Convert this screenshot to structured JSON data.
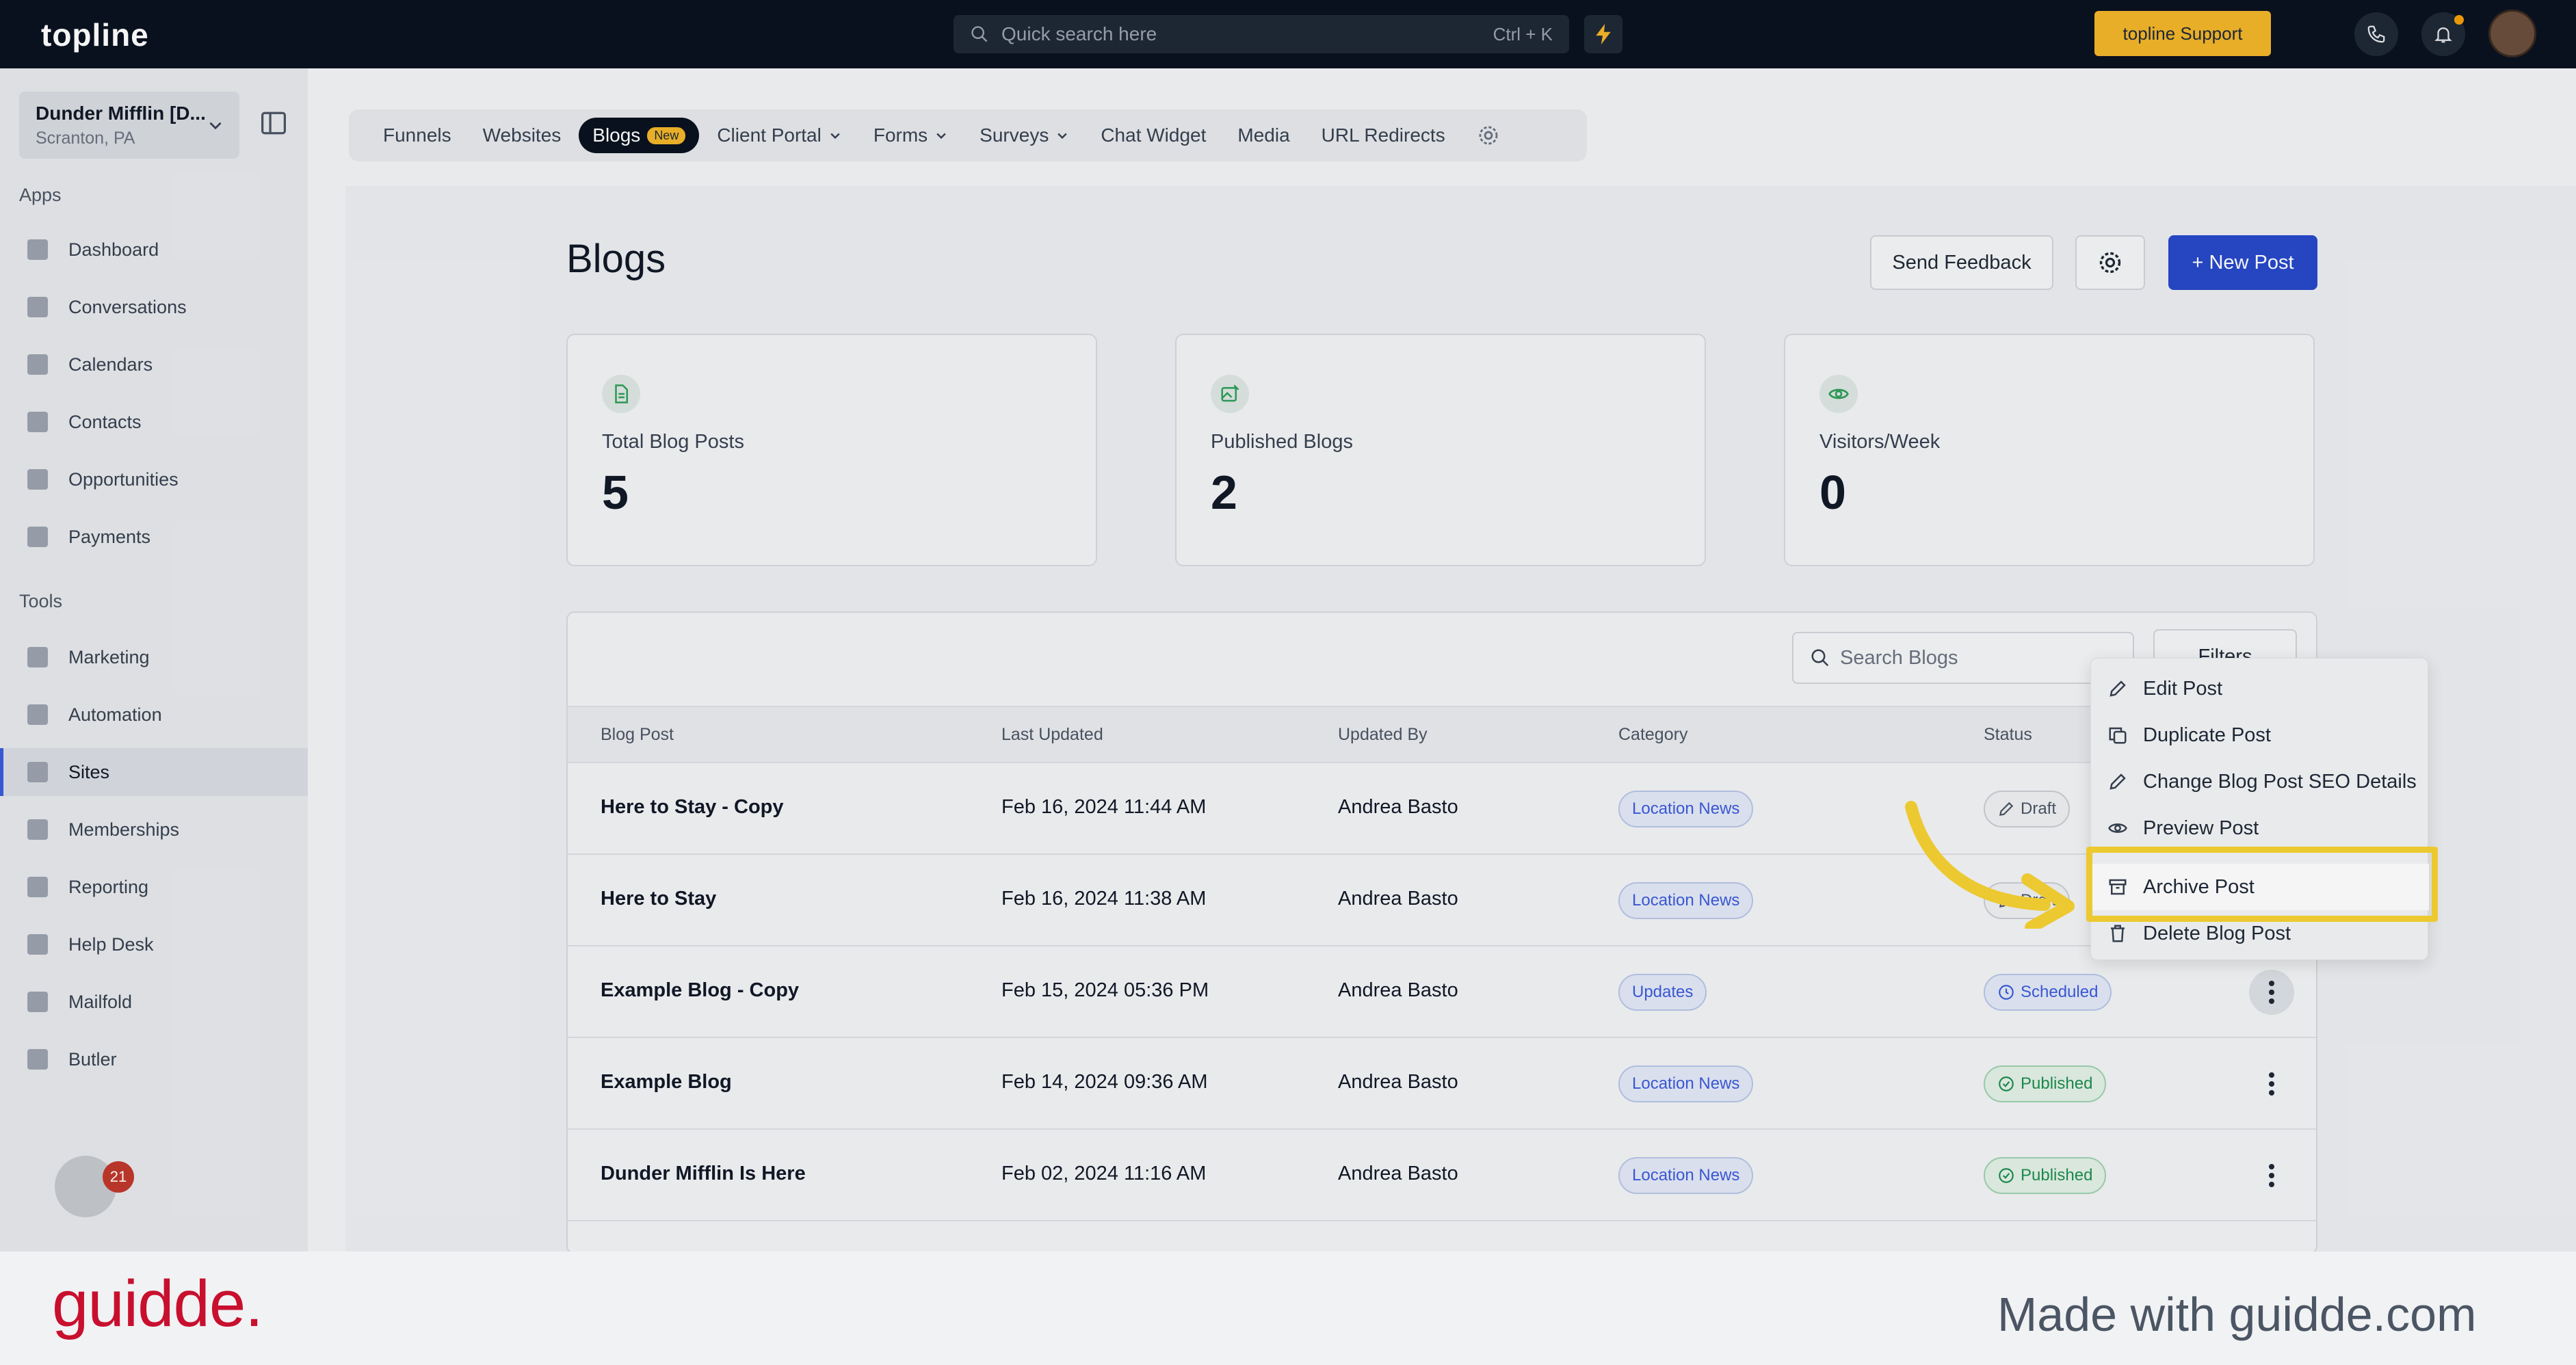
{
  "topbar": {
    "logo": "topline",
    "search_placeholder": "Quick search here",
    "search_shortcut": "Ctrl + K",
    "support_label": "topline Support"
  },
  "sidebar": {
    "account_name": "Dunder Mifflin [D...",
    "account_location": "Scranton, PA",
    "apps_label": "Apps",
    "tools_label": "Tools",
    "apps": [
      {
        "label": "Dashboard",
        "icon": "dashboard-icon"
      },
      {
        "label": "Conversations",
        "icon": "chat-icon"
      },
      {
        "label": "Calendars",
        "icon": "calendar-icon"
      },
      {
        "label": "Contacts",
        "icon": "person-icon"
      },
      {
        "label": "Opportunities",
        "icon": "target-icon"
      },
      {
        "label": "Payments",
        "icon": "card-icon"
      }
    ],
    "tools": [
      {
        "label": "Marketing",
        "icon": "megaphone-icon"
      },
      {
        "label": "Automation",
        "icon": "gears-icon"
      },
      {
        "label": "Sites",
        "icon": "globe-icon",
        "active": true
      },
      {
        "label": "Memberships",
        "icon": "users-icon"
      },
      {
        "label": "Reporting",
        "icon": "pie-icon"
      },
      {
        "label": "Help Desk",
        "icon": "help-icon"
      },
      {
        "label": "Mailfold",
        "icon": "mail-icon"
      },
      {
        "label": "Butler",
        "icon": "butler-icon"
      }
    ],
    "badge_count": "21"
  },
  "subnav": {
    "tabs": [
      "Funnels",
      "Websites",
      "Blogs",
      "Client Portal",
      "Forms",
      "Surveys",
      "Chat Widget",
      "Media",
      "URL Redirects"
    ],
    "new_badge": "New"
  },
  "page": {
    "title": "Blogs",
    "send_feedback": "Send Feedback",
    "new_post": "+ New Post"
  },
  "stats": [
    {
      "label": "Total Blog Posts",
      "value": "5",
      "icon": "document-icon"
    },
    {
      "label": "Published Blogs",
      "value": "2",
      "icon": "image-edit-icon"
    },
    {
      "label": "Visitors/Week",
      "value": "0",
      "icon": "eye-icon"
    }
  ],
  "table": {
    "search_placeholder": "Search Blogs",
    "filters_label": "Filters",
    "headers": [
      "Blog Post",
      "Last Updated",
      "Updated By",
      "Category",
      "Status"
    ],
    "rows": [
      {
        "title": "Here to Stay - Copy",
        "updated": "Feb 16, 2024 11:44 AM",
        "by": "Andrea Basto",
        "category": "Location News",
        "status": "Draft",
        "status_type": "draft"
      },
      {
        "title": "Here to Stay",
        "updated": "Feb 16, 2024 11:38 AM",
        "by": "Andrea Basto",
        "category": "Location News",
        "status": "Draft",
        "status_type": "draft"
      },
      {
        "title": "Example Blog - Copy",
        "updated": "Feb 15, 2024 05:36 PM",
        "by": "Andrea Basto",
        "category": "Updates",
        "status": "Scheduled",
        "status_type": "sched"
      },
      {
        "title": "Example Blog",
        "updated": "Feb 14, 2024 09:36 AM",
        "by": "Andrea Basto",
        "category": "Location News",
        "status": "Published",
        "status_type": "pub"
      },
      {
        "title": "Dunder Mifflin Is Here",
        "updated": "Feb 02, 2024 11:16 AM",
        "by": "Andrea Basto",
        "category": "Location News",
        "status": "Published",
        "status_type": "pub"
      }
    ]
  },
  "menu": {
    "items": [
      {
        "label": "Edit Post",
        "icon": "pencil-icon"
      },
      {
        "label": "Duplicate Post",
        "icon": "copy-icon"
      },
      {
        "label": "Change Blog Post SEO Details",
        "icon": "pencil-icon"
      },
      {
        "label": "Preview Post",
        "icon": "eye-icon"
      },
      {
        "label": "Archive Post",
        "icon": "archive-icon",
        "highlighted": true
      },
      {
        "label": "Delete Blog Post",
        "icon": "trash-icon"
      }
    ]
  },
  "footer": {
    "logo": "guidde.",
    "text": "Made with guidde.com"
  },
  "colors": {
    "topbar": "#0b1220",
    "accent": "#2748c9",
    "support": "#f2b62a",
    "highlight": "#f7d233",
    "brand_red": "#c8102e"
  }
}
